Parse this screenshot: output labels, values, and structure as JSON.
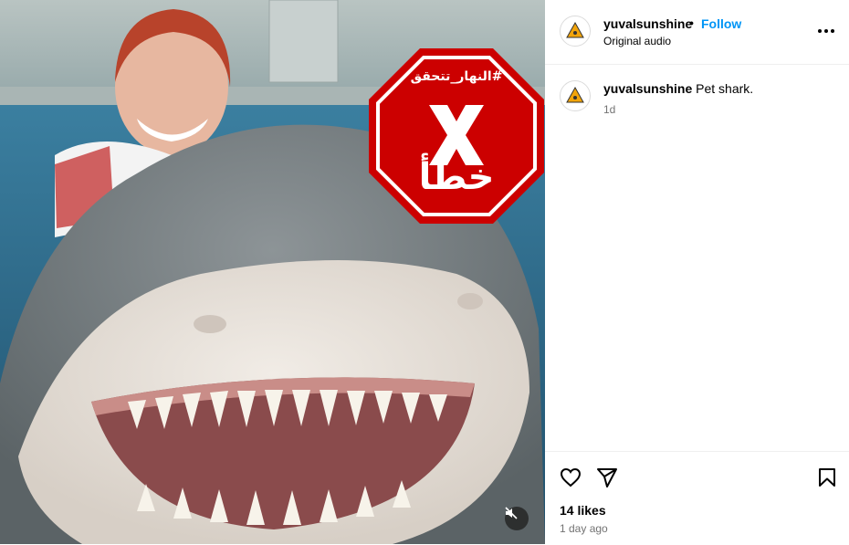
{
  "post": {
    "author": "yuvalsunshine",
    "separator": "•",
    "follow_label": "Follow",
    "audio_label": "Original audio",
    "caption_author": "yuvalsunshine",
    "caption_text": "Pet shark.",
    "caption_age": "1d",
    "likes": "14 likes",
    "date": "1 day ago"
  },
  "media": {
    "description_icon": "muted-speaker-icon",
    "stamp": {
      "hashtag": "#النهار_تتحقق",
      "verdict": "خطأ",
      "color": "#cc0000"
    }
  },
  "icons": {
    "like": "heart-icon",
    "share": "paper-plane-icon",
    "save": "bookmark-icon",
    "more": "more-options-icon"
  },
  "colors": {
    "accent": "#0095f6",
    "muted": "#737373"
  }
}
